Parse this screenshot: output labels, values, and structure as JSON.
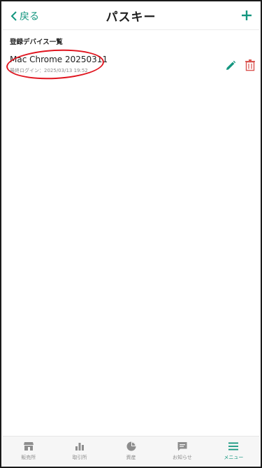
{
  "header": {
    "back_label": "戻る",
    "title": "パスキー"
  },
  "section": {
    "title": "登録デバイス一覧"
  },
  "devices": [
    {
      "name": "Mac Chrome 20250311",
      "last_login": "最終ログイン：2025/03/13 19:52"
    }
  ],
  "bottom_nav": [
    {
      "label": "販売所",
      "icon": "store-icon"
    },
    {
      "label": "取引所",
      "icon": "bar-chart-icon"
    },
    {
      "label": "資産",
      "icon": "pie-chart-icon"
    },
    {
      "label": "お知らせ",
      "icon": "message-icon"
    },
    {
      "label": "メニュー",
      "icon": "menu-icon",
      "active": true
    }
  ],
  "colors": {
    "accent": "#13967f",
    "delete": "#d9534f",
    "highlight": "#e0141e",
    "inactive": "#8d8d8d"
  }
}
